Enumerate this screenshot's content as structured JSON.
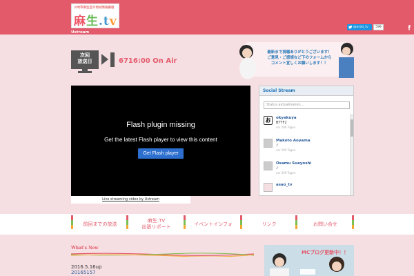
{
  "header": {
    "logo_tagline": "川崎市麻生区の地域情報番組",
    "logo_text_1": "麻",
    "logo_text_2": "生",
    "logo_text_3": ".t",
    "logo_text_4": "v",
    "section_label": "Ustream",
    "twitter_label": "@asao_tv",
    "twitter_count": "599"
  },
  "schedule": {
    "label_line1": "次回",
    "label_line2": "放送日",
    "status": "6716:00 On Air"
  },
  "banner": {
    "line1": "最新まで視聴ありがとうございます！",
    "line2": "ご意見・ご感想など下のフォームから",
    "line3": "コメント宜しくお願いします！！"
  },
  "video": {
    "flash_title": "Flash plugin missing",
    "flash_desc": "Get the latest Flash player to view this content",
    "flash_button": "Get Flash player",
    "caption": "Live streaming video by Ustream"
  },
  "social": {
    "header": "Social Stream",
    "status_placeholder": "Status aktualisieren...",
    "items": [
      {
        "name": "okyakuya",
        "msg": "BTTF2",
        "time": "vor 209 Tagen",
        "avatar": "お"
      },
      {
        "name": "Makoto Aoyama",
        "msg": "♪",
        "time": "vor 209 Tagen"
      },
      {
        "name": "Osamu Sueyoshi",
        "msg": "♪",
        "time": "vor 209 Tagen"
      },
      {
        "name": "asao_tv",
        "msg": "",
        "time": ""
      }
    ]
  },
  "nav": {
    "items": [
      {
        "line1": "前回までの放送",
        "line2": ""
      },
      {
        "line1": "麻生.TV",
        "line2": "出張リポート"
      },
      {
        "line1": "イベントインフォ",
        "line2": ""
      },
      {
        "line1": "リンク",
        "line2": ""
      },
      {
        "line1": "お問い合せ",
        "line2": ""
      }
    ]
  },
  "news": {
    "heading": "What's New",
    "date": "2016.5.16up",
    "title": "20165157"
  },
  "blog": {
    "text": "MCブログ更新中！！"
  }
}
